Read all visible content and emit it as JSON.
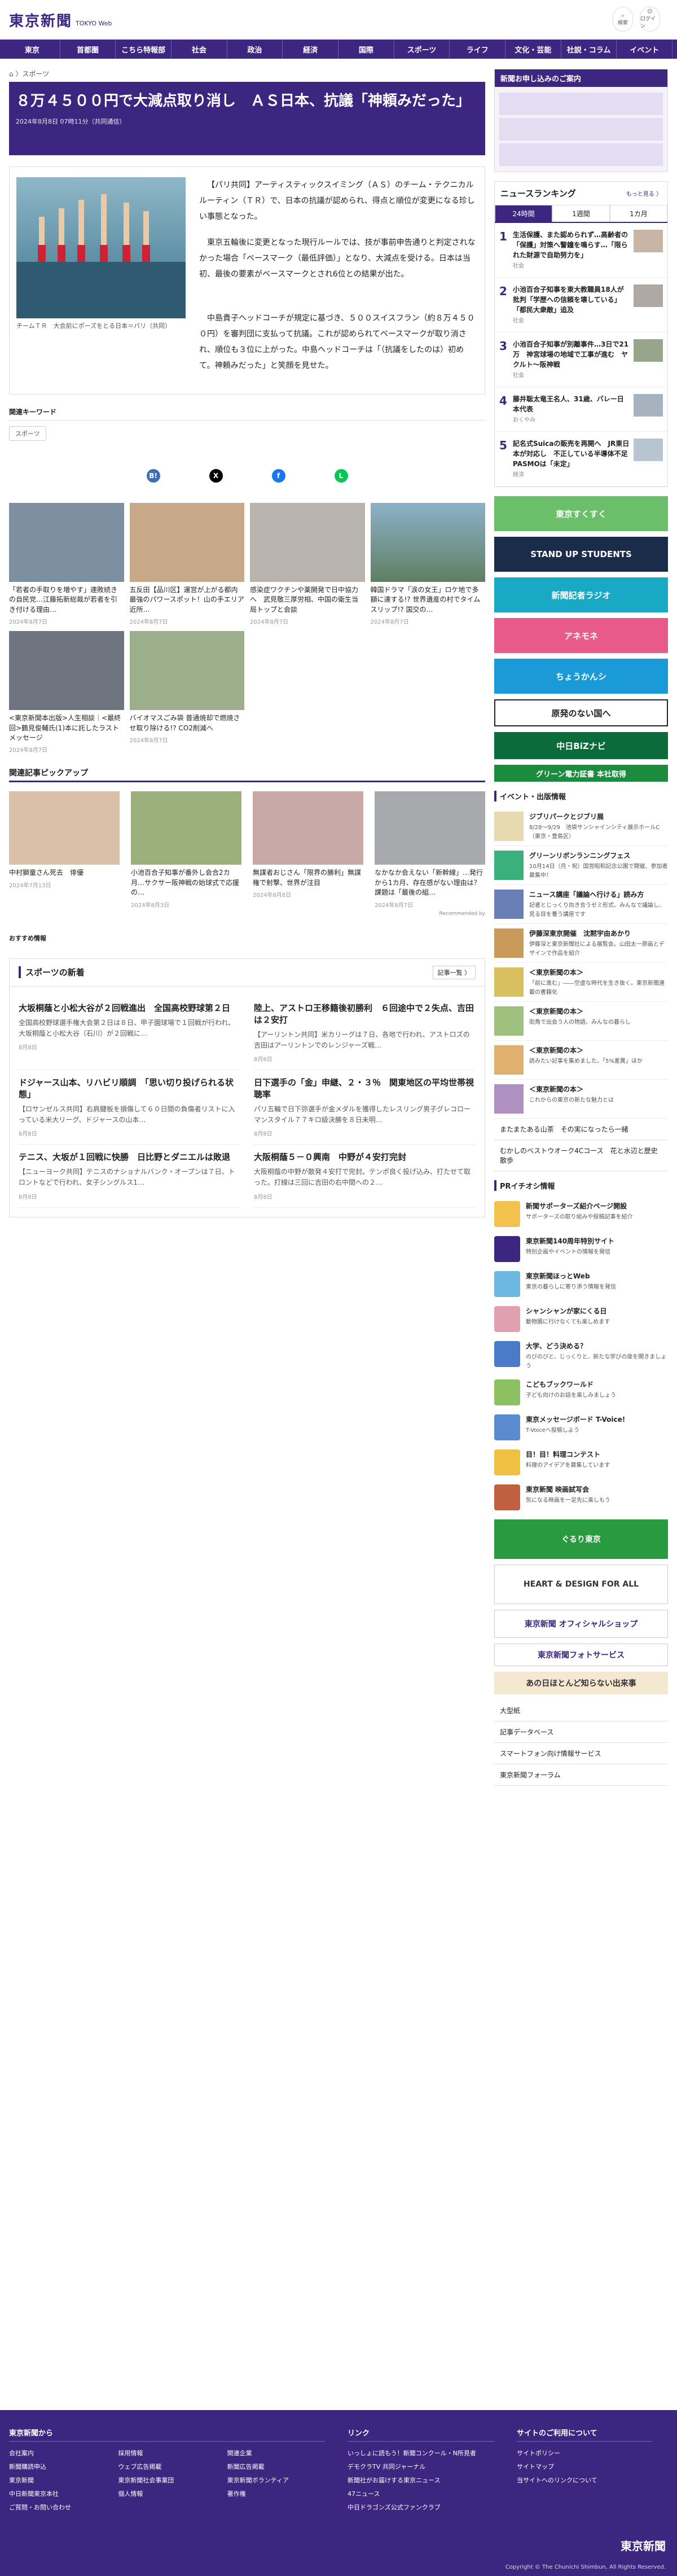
{
  "header": {
    "logo": "東京新聞",
    "logo_sub": "TOKYO Web",
    "search": "検索",
    "menu": "ログイン"
  },
  "nav": [
    "東京",
    "首都圏",
    "こちら特報部",
    "社会",
    "政治",
    "経済",
    "国際",
    "スポーツ",
    "ライフ",
    "文化・芸能",
    "社説・コラム",
    "イベント"
  ],
  "breadcrumb": "⌂ 〉スポーツ",
  "article": {
    "title": "８万４５００円で大減点取り消し　ＡＳ日本、抗議「神頼みだった」",
    "date": "2024年8月8日 07時11分（共同通信）",
    "caption": "チームＴＲ　大会前にポーズをとる日本＝パリ（共同）",
    "paragraphs": [
      "【パリ共同】アーティスティックスイミング（ＡＳ）のチーム・テクニカルルーティン（ＴＲ）で、日本の抗議が認められ、得点と順位が変更になる珍しい事態となった。",
      "東京五輪後に変更となった現行ルールでは、技が事前申告通りと判定されなかった場合「ベースマーク（最低評価）」となり、大減点を受ける。日本は当初、最後の要素がベースマークとされ6位との結果が出た。",
      "中島貴子ヘッドコーチが規定に基づき、５００スイスフラン（約８万４５００円）を審判団に支払って抗議。これが認められてベースマークが取り消され、順位も３位に上がった。中島ヘッドコーチは「（抗議をしたのは）初めて。神頼みだった」と笑顔を見せた。"
    ],
    "kw_label": "関連キーワード",
    "kw": "スポーツ"
  },
  "related": [
    {
      "t": "「若者の手取りを増やす」連敗続きの自民党…江藤拓新総裁が若者を引き付ける理由…",
      "d": "2024年8月7日"
    },
    {
      "t": "五反田【品川区】運営が上がる都内最強のパワースポット！山の手エリア近所…",
      "d": "2024年8月7日"
    },
    {
      "t": "感染症ワクチンや薬開発で日中協力へ　武見敬三厚労相、中国の衛生当局トップと会談",
      "d": "2024年8月7日"
    },
    {
      "t": "韓国ドラマ「涙の女王」ロケ地で多額に達する!? 世界遺産の村でタイムスリップ!? 国交の…",
      "d": "2024年8月7日"
    },
    {
      "t": "<東京新聞本出版>人生相談｜<最終回>鶴見俊輔氏(1)本に託したラストメッセージ",
      "d": "2024年8月7日"
    },
    {
      "t": "バイオマスごみ袋 普通焼却で燃焼させ取り除ける!? CO2削減へ",
      "d": "2024年8月7日"
    }
  ],
  "pick_label": "関連記事ピックアップ",
  "picks": [
    {
      "t": "中村獅童さん死去　俳優",
      "d": "2024年7月13日"
    },
    {
      "t": "小池百合子知事が番外し会合2カ月…サクサー阪神戦の始球式で応援の…",
      "d": "2024年8月3日"
    },
    {
      "t": "無謀者おじさん「限界の勝利」無謀権で射撃、世界が注目",
      "d": "2024年8月8日"
    },
    {
      "t": "なかなか会えない「新幹線」…発行から1カ月、存在感がない理由は？　課題は「最後の組…",
      "d": "2024年8月7日"
    }
  ],
  "recommend": "Recommended by",
  "osusume": "おすすめ情報",
  "sports": {
    "title": "スポーツの新着",
    "more": "記事一覧 〉",
    "items": [
      {
        "h": "大坂桐蔭と小松大谷が２回戦進出　全国高校野球第２日",
        "p": "全国高校野球選手権大会第２日は８日、甲子園球場で１回戦が行われ、大坂桐蔭と小松大谷（石川）が２回戦に…",
        "d": "8月8日"
      },
      {
        "h": "陸上、アストロ王移籍後初勝利　６回途中で２失点、吉田は２安打",
        "p": "【アーリントン共同】米カリーグは７日、各地で行われ、アストロズの吉田はアーリントンでのレンジャーズ戦…",
        "d": "8月8日"
      },
      {
        "h": "ドジャース山本、リハビリ順調　「思い切り投げられる状態」",
        "p": "【ロサンゼルス共同】右肩腱板を損傷して６０日間の負傷者リストに入っている米大リーグ、ドジャースの山本…",
        "d": "8月8日"
      },
      {
        "h": "日下選手の「金」申継、２・３％　関東地区の平均世帯視聴率",
        "p": "パリ五輪で日下弥選手が金メダルを獲得したレスリング男子グレコローマンスタイル７７キロ級決勝を８日未明…",
        "d": "8月8日"
      },
      {
        "h": "テニス、大坂が１回戦に快勝　日比野とダニエルは敗退",
        "p": "【ニューヨーク共同】テニスのナショナルバンク・オープンは７日、トロントなどで行われ、女子シングルス1…",
        "d": "8月8日"
      },
      {
        "h": "大阪桐蔭５－０興南　中野が４安打完封",
        "p": "大阪桐蔭の中野が散発４安打で完封。テンポ良く投げ込み、打たせて取った。打線は三回に吉田の右中間への２…",
        "d": "8月8日"
      }
    ]
  },
  "side": {
    "promo_title": "新聞お申し込みのご案内",
    "ranking_title": "ニュースランキング",
    "ranking_more": "もっと見る 〉",
    "tabs": [
      "24時間",
      "1週間",
      "1カ月"
    ],
    "ranks": [
      {
        "n": "1",
        "t": "生活保護、また認められず…高齢者の「保護」対策へ警鐘を鳴らす…「限られた財源で自助努力を」",
        "s": "社会"
      },
      {
        "n": "2",
        "t": "小池百合子知事を東大教職員18人が批判「学歴への信頼を壊している」「都民大衆敵」追及",
        "s": "社会"
      },
      {
        "n": "3",
        "t": "小池百合子知事が別離事件…3日で21万　神宮球場の地域で工事が進む　ヤクルト～阪神戦",
        "s": "社会"
      },
      {
        "n": "4",
        "t": "藤井聡太竜王名人、31歳、バレー日本代表",
        "s": "おくやみ"
      },
      {
        "n": "5",
        "t": "記名式Suicaの販売を再開へ　JR東日本が対応し　不正している半導体不足　PASMOは「未定」",
        "s": "経済"
      }
    ],
    "banners": [
      "東京すくすく",
      "STAND UP STUDENTS",
      "新聞記者ラジオ",
      "アネモネ",
      "ちょうかんシ",
      "原発のない国へ",
      "中日BiZナビ",
      "グリーン電力証書 本社取得"
    ],
    "event_title": "イベント・出版情報",
    "events": [
      {
        "b": "ジブリパークとジブリ展",
        "s": "8/28～9/29　池袋サンシャインシティ展示ホールC（東京・豊島区）"
      },
      {
        "b": "グリーンリボンランニングフェス",
        "s": "10月14日（月・祝）国営昭和記念公園で開催、参加者募集中！"
      },
      {
        "b": "ニュース講座「議論へ行ける」読み方",
        "s": "記者とじっくり向き合うゼミ形式、みんなで議論し、見る目を養う講座です"
      },
      {
        "b": "伊藤深東京開催　沈黙宇由あかり",
        "s": "伊藤深と東京新聞社による展覧会。山田太一原画とデザインで作品を紹介"
      },
      {
        "b": "＜東京新聞の本＞",
        "s": "「前に進む」――空虚な時代を生き抜く。東京新聞連載の書籍化"
      },
      {
        "b": "＜東京新聞の本＞",
        "s": "街角で出会う人の物語、みんなの暮らし"
      },
      {
        "b": "＜東京新聞の本＞",
        "s": "読みたい記事を集めました。「5%差異」ほか"
      },
      {
        "b": "＜東京新聞の本＞",
        "s": "これからの東京の新たな魅力とは"
      }
    ],
    "texts": [
      "またまたある山茶　その実になったら一緒",
      "むかしのベストウオーク4Cコース　花と水辺と歴史散歩"
    ],
    "pr_title": "PRイチオシ情報",
    "prs": [
      {
        "b": "新聞サポーターズ紹介ページ開設",
        "s": "サポーターズの取り組みや投稿記事を紹介"
      },
      {
        "b": "東京新聞140周年特別サイト",
        "s": "特別企画やイベントの情報を発信"
      },
      {
        "b": "東京新聞ほっとWeb",
        "s": "東京の暮らしに寄り添う情報を発信"
      },
      {
        "b": "シャンシャンが家にくる日",
        "s": "動物園に行けなくても楽しめます"
      },
      {
        "b": "大学、どう決める？",
        "s": "のびのびと、じっくりと、新たな学びの扉を開きましょう"
      },
      {
        "b": "こどもブックワールド",
        "s": "子ども向けのお話を楽しみましょう"
      },
      {
        "b": "東京メッセージボード T-Voice!",
        "s": "T-Voiceへ投稿しよう"
      },
      {
        "b": "目！目！料理コンテスト",
        "s": "料理のアイデアを募集しています"
      },
      {
        "b": "東京新聞 映画試写会",
        "s": "気になる映画を一足先に楽しもう"
      }
    ],
    "ads": [
      "ぐるり東京",
      "HEART & DESIGN FOR ALL",
      "東京新聞 オフィシャルショップ",
      "東京新聞フォトサービス",
      "あの日ほとんど知らない出来事"
    ],
    "links": [
      "大型紙",
      "記事データベース",
      "スマートフォン向け情報サービス",
      "東京新聞フォーラム"
    ]
  },
  "footer": {
    "col1_title": "東京新聞から",
    "col1": [
      "会社案内",
      "採用情報",
      "関連企業",
      "新聞購読申込",
      "ウェブ広告掲載",
      "新聞広告掲載",
      "東京新聞",
      "東京新聞社会事業団",
      "東京新聞ボランティア",
      "中日新聞東京本社",
      "個人情報",
      "著作権",
      "ご質問・お問い合わせ"
    ],
    "col2_title": "リンク",
    "col2": [
      "いっしょに読もう！新聞コンクール・N所見者",
      "デモクラTV 共同ジャーナル",
      "新聞社がお届けする東京ニュース",
      "47ニュース",
      "中日ドラゴンズ公式ファンクラブ"
    ],
    "col3_title": "サイトのご利用について",
    "col3": [
      "サイトポリシー",
      "サイトマップ",
      "当サイトへのリンクについて"
    ],
    "logo": "東京新聞",
    "copy": "Copyright © The Chunichi Shimbun, All Rights Reserved."
  }
}
